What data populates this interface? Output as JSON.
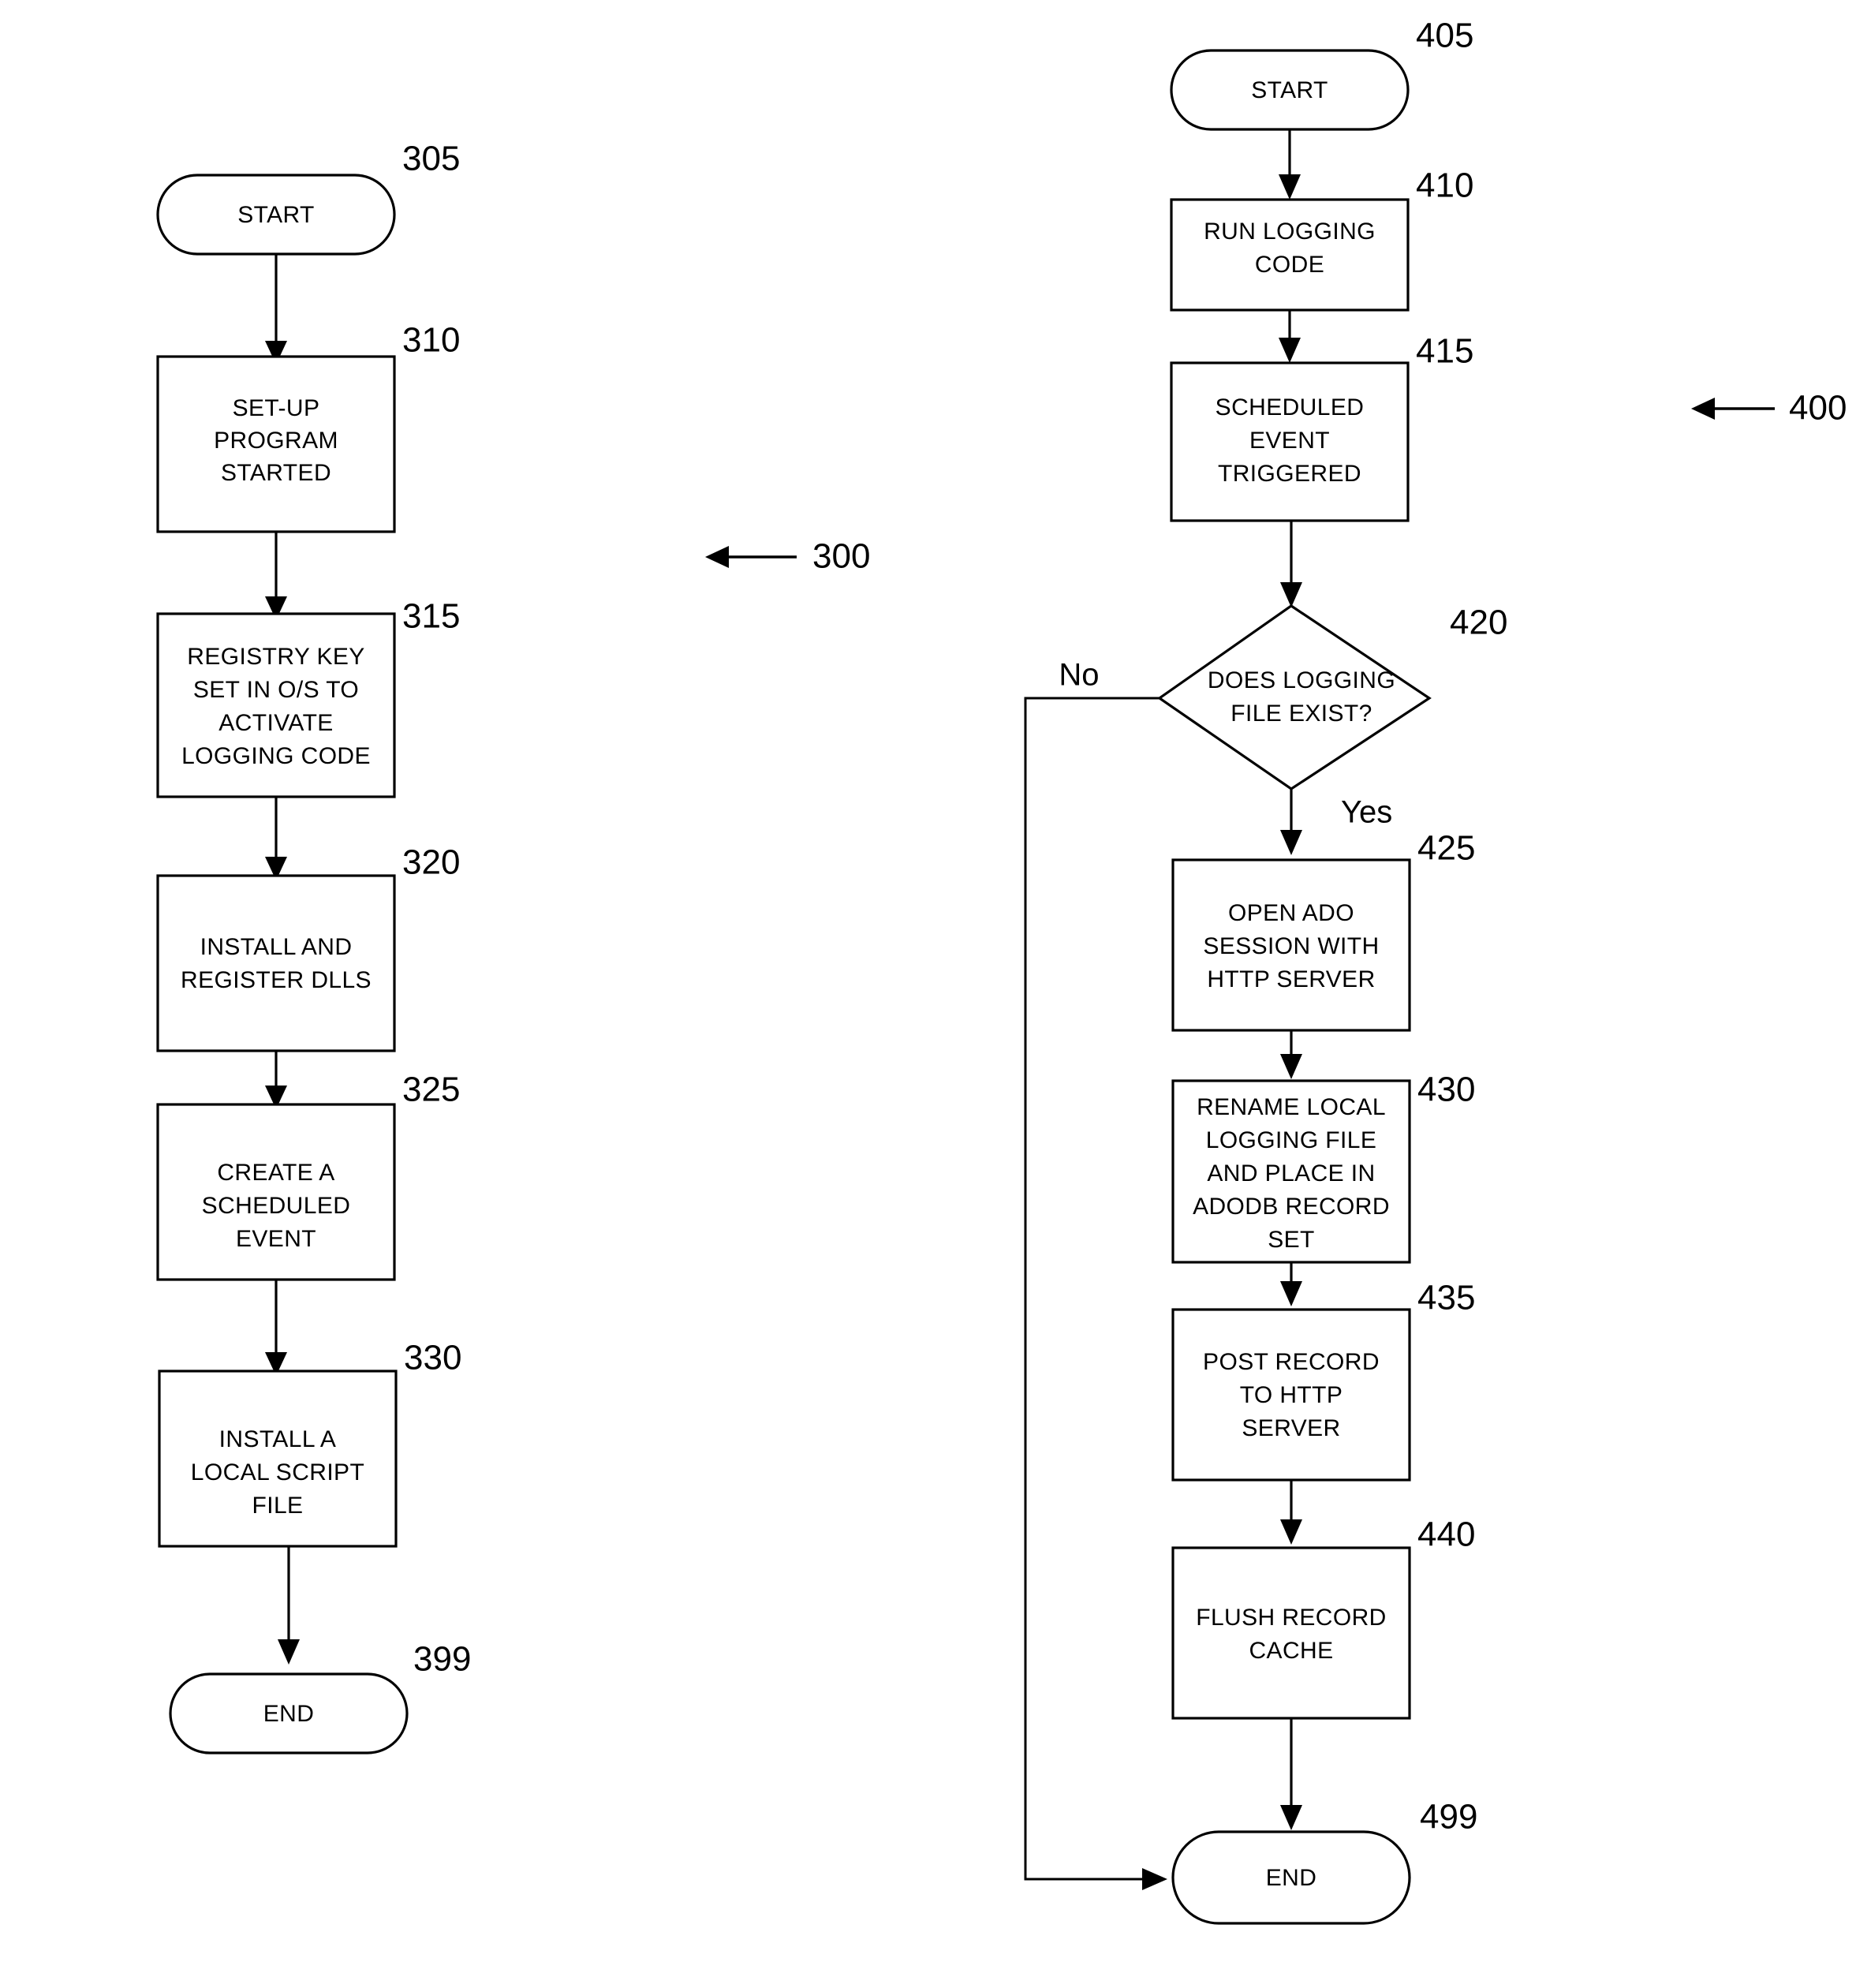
{
  "figure": {
    "background_color": "#ffffff",
    "stroke_color": "#000000"
  },
  "flowcharts": [
    {
      "id": "flowchart-300",
      "ref_label": "300",
      "nodes": [
        {
          "ref": "305",
          "type": "terminator",
          "lines": [
            "START"
          ]
        },
        {
          "ref": "310",
          "type": "process",
          "lines": [
            "SET-UP",
            "PROGRAM",
            "STARTED"
          ]
        },
        {
          "ref": "315",
          "type": "process",
          "lines": [
            "REGISTRY KEY",
            "SET IN O/S TO",
            "ACTIVATE",
            "LOGGING CODE"
          ]
        },
        {
          "ref": "320",
          "type": "process",
          "lines": [
            "INSTALL AND",
            "REGISTER DLLS"
          ]
        },
        {
          "ref": "325",
          "type": "process",
          "lines": [
            "CREATE A",
            "SCHEDULED",
            "EVENT"
          ]
        },
        {
          "ref": "330",
          "type": "process",
          "lines": [
            "INSTALL A",
            "LOCAL SCRIPT",
            "FILE"
          ]
        },
        {
          "ref": "399",
          "type": "terminator",
          "lines": [
            "END"
          ]
        }
      ]
    },
    {
      "id": "flowchart-400",
      "ref_label": "400",
      "nodes": [
        {
          "ref": "405",
          "type": "terminator",
          "lines": [
            "START"
          ]
        },
        {
          "ref": "410",
          "type": "process",
          "lines": [
            "RUN LOGGING",
            "CODE"
          ]
        },
        {
          "ref": "415",
          "type": "process",
          "lines": [
            "SCHEDULED",
            "EVENT",
            "TRIGGERED"
          ]
        },
        {
          "ref": "420",
          "type": "decision",
          "lines": [
            "DOES LOGGING",
            "FILE EXIST?"
          ]
        },
        {
          "ref": "425",
          "type": "process",
          "lines": [
            "OPEN ADO",
            "SESSION WITH",
            "HTTP SERVER"
          ]
        },
        {
          "ref": "430",
          "type": "process",
          "lines": [
            "RENAME LOCAL",
            "LOGGING FILE",
            "AND PLACE IN",
            "ADODB RECORD",
            "SET"
          ]
        },
        {
          "ref": "435",
          "type": "process",
          "lines": [
            "POST RECORD",
            "TO HTTP",
            "SERVER"
          ]
        },
        {
          "ref": "440",
          "type": "process",
          "lines": [
            "FLUSH RECORD",
            "CACHE"
          ]
        },
        {
          "ref": "499",
          "type": "terminator",
          "lines": [
            "END"
          ]
        }
      ],
      "branch_labels": {
        "no": "No",
        "yes": "Yes"
      }
    }
  ]
}
